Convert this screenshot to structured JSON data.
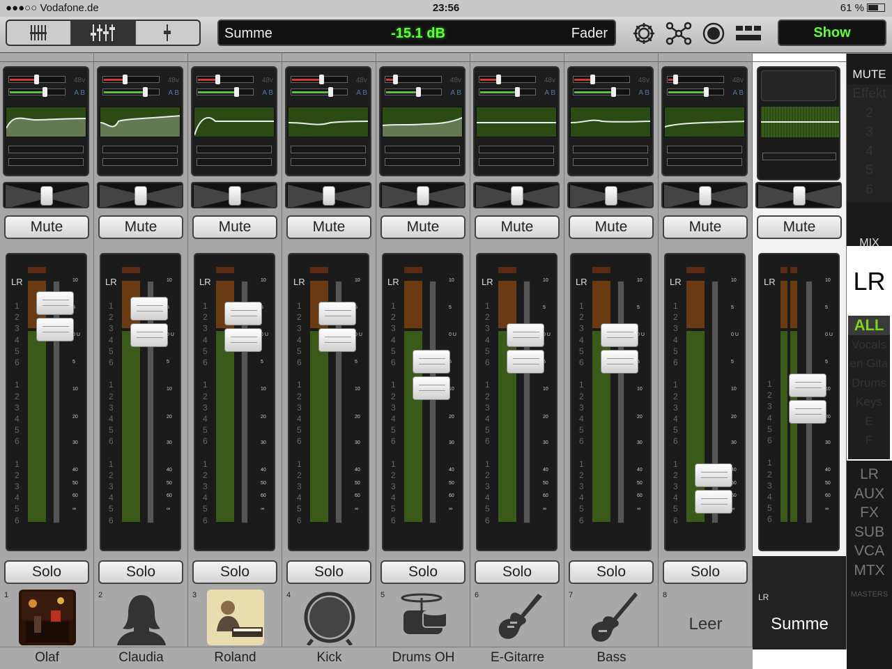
{
  "statusbar": {
    "carrier": "●●●○○ Vodafone.de",
    "time": "23:56",
    "battery": "61 %"
  },
  "toolbar": {
    "display_name": "Summe",
    "display_value": "-15.1 dB",
    "display_mode": "Fader",
    "show_label": "Show"
  },
  "labels": {
    "mute": "Mute",
    "solo": "Solo",
    "lr": "LR",
    "tag48v": "48v",
    "tagab": "A B"
  },
  "channels": [
    {
      "num": "1",
      "name": "Olaf",
      "icon": "photo-band",
      "fader_db": 3
    },
    {
      "num": "2",
      "name": "Claudia",
      "icon": "female-silhouette",
      "fader_db": 2
    },
    {
      "num": "3",
      "name": "Roland",
      "icon": "photo-keyboard-player",
      "fader_db": 1
    },
    {
      "num": "4",
      "name": "Kick",
      "icon": "kick-drum-icon",
      "fader_db": 1
    },
    {
      "num": "5",
      "name": "Drums OH",
      "icon": "drum-kit-icon",
      "fader_db": -8
    },
    {
      "num": "6",
      "name": "E-Gitarre",
      "icon": "electric-guitar-icon",
      "fader_db": -3
    },
    {
      "num": "7",
      "name": "Bass",
      "icon": "bass-guitar-icon",
      "fader_db": -3
    },
    {
      "num": "8",
      "name": "",
      "empty_label": "Leer",
      "icon": "none",
      "fader_db": -60
    }
  ],
  "master": {
    "label": "LR",
    "name": "Summe",
    "fader_db": -15.1
  },
  "scale_marks": [
    "10",
    "5",
    "0 U",
    "5",
    "10",
    "20",
    "30",
    "40",
    "50",
    "60",
    "∞"
  ],
  "bus_numbers": [
    "1",
    "2",
    "3",
    "4",
    "5",
    "6",
    "",
    "1",
    "2",
    "3",
    "4",
    "5",
    "6",
    "",
    "1",
    "2",
    "3",
    "4",
    "5",
    "6"
  ],
  "sidebar": {
    "mute_label": "MUTE",
    "mix_items": [
      "Effekt",
      "2",
      "3",
      "4",
      "5",
      "6"
    ],
    "mix_label": "MIX",
    "lr_label": "LR",
    "groups": [
      "ALL",
      "Vocals",
      "en Gita",
      "Drums",
      "Keys",
      "E",
      "F"
    ],
    "masters": [
      "LR",
      "AUX",
      "FX",
      "SUB",
      "VCA",
      "MTX"
    ],
    "masters_label": "MASTERS"
  },
  "colors": {
    "accent_green": "#5cff3a",
    "eq_bg": "#2c4a14"
  }
}
